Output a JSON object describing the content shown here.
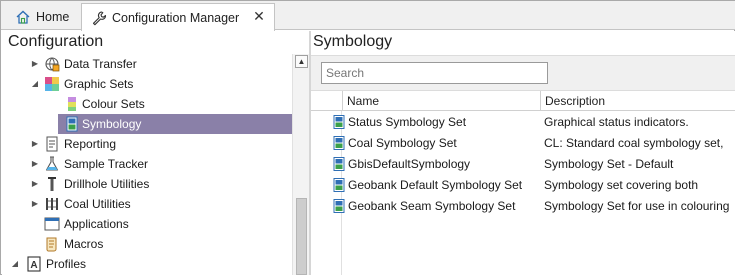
{
  "tabs": [
    {
      "label": "Home",
      "icon": "home-icon"
    },
    {
      "label": "Configuration Manager",
      "icon": "wrench-icon",
      "close": "✕"
    }
  ],
  "left_pane": {
    "title": "Configuration",
    "tree": [
      {
        "label": "Data Transfer",
        "icon": "globe-transfer-icon",
        "arrow": "collapsed",
        "level": 1
      },
      {
        "label": "Graphic Sets",
        "icon": "graphic-sets-icon",
        "arrow": "expanded",
        "level": 1
      },
      {
        "label": "Colour Sets",
        "icon": "colour-sets-icon",
        "arrow": "none",
        "level": 2
      },
      {
        "label": "Symbology",
        "icon": "symbology-icon",
        "arrow": "none",
        "level": 2,
        "selected": true
      },
      {
        "label": "Reporting",
        "icon": "reporting-icon",
        "arrow": "collapsed",
        "level": 1
      },
      {
        "label": "Sample Tracker",
        "icon": "flask-icon",
        "arrow": "collapsed",
        "level": 1
      },
      {
        "label": "Drillhole Utilities",
        "icon": "drillhole-icon",
        "arrow": "collapsed",
        "level": 1
      },
      {
        "label": "Coal Utilities",
        "icon": "coal-icon",
        "arrow": "collapsed",
        "level": 1
      },
      {
        "label": "Applications",
        "icon": "applications-icon",
        "arrow": "none",
        "level": 1
      },
      {
        "label": "Macros",
        "icon": "scroll-icon",
        "arrow": "none",
        "level": 1
      },
      {
        "label": "Profiles",
        "icon": "profiles-icon",
        "arrow": "expanded",
        "level": 0
      }
    ]
  },
  "right_pane": {
    "title": "Symbology",
    "search_placeholder": "Search",
    "columns": [
      "Name",
      "Description"
    ],
    "rows": [
      {
        "name": "Status Symbology Set",
        "description": "Graphical status indicators."
      },
      {
        "name": "Coal Symbology Set",
        "description": "CL: Standard coal symbology set,"
      },
      {
        "name": "GbisDefaultSymbology",
        "description": "Symbology Set - Default"
      },
      {
        "name": "Geobank Default Symbology Set",
        "description": "Symbology set covering both"
      },
      {
        "name": "Geobank Seam Symbology Set",
        "description": "Symbology Set for use in colouring"
      }
    ]
  },
  "colors": {
    "selected_row": "#8a80a8",
    "tab_bg": "#f0f0f0",
    "symbology_icon_blue": "#2f6fb5",
    "symbology_icon_green": "#3aa04a"
  }
}
